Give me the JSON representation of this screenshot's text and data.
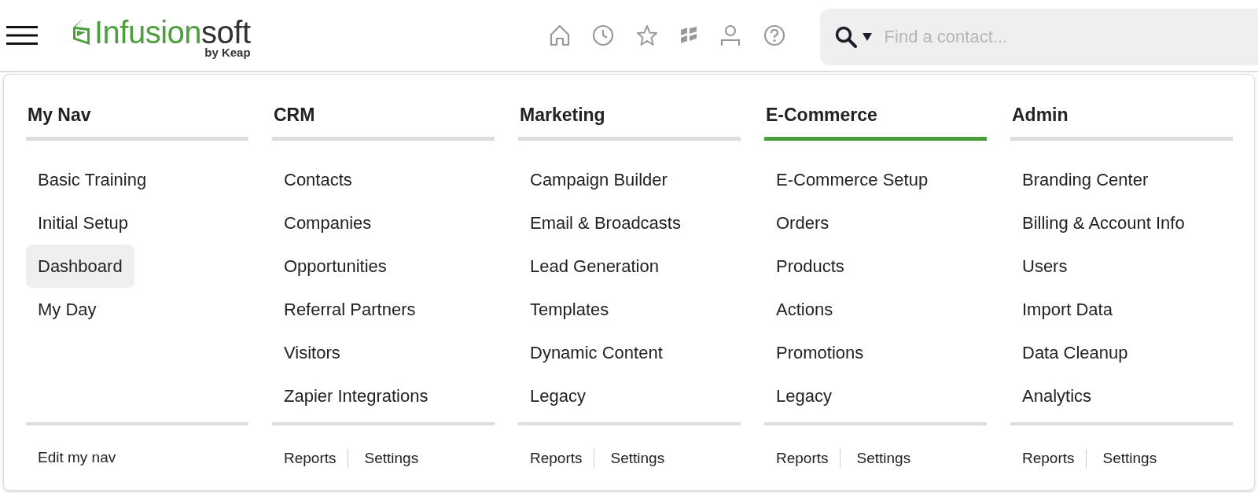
{
  "header": {
    "brand": {
      "primary": "Infusion",
      "secondary": "soft",
      "tagline": "by Keap"
    },
    "search": {
      "placeholder": "Find a contact..."
    }
  },
  "columns": [
    {
      "title": "My Nav",
      "selected": false,
      "items": [
        {
          "label": "Basic Training",
          "selected": false
        },
        {
          "label": "Initial Setup",
          "selected": false
        },
        {
          "label": "Dashboard",
          "selected": true
        },
        {
          "label": "My Day",
          "selected": false
        }
      ],
      "footer": [
        "Edit my nav"
      ]
    },
    {
      "title": "CRM",
      "selected": false,
      "items": [
        {
          "label": "Contacts",
          "selected": false
        },
        {
          "label": "Companies",
          "selected": false
        },
        {
          "label": "Opportunities",
          "selected": false
        },
        {
          "label": "Referral Partners",
          "selected": false
        },
        {
          "label": "Visitors",
          "selected": false
        },
        {
          "label": "Zapier Integrations",
          "selected": false
        }
      ],
      "footer": [
        "Reports",
        "Settings"
      ]
    },
    {
      "title": "Marketing",
      "selected": false,
      "items": [
        {
          "label": "Campaign Builder",
          "selected": false
        },
        {
          "label": "Email & Broadcasts",
          "selected": false
        },
        {
          "label": "Lead Generation",
          "selected": false
        },
        {
          "label": "Templates",
          "selected": false
        },
        {
          "label": "Dynamic Content",
          "selected": false
        },
        {
          "label": "Legacy",
          "selected": false
        }
      ],
      "footer": [
        "Reports",
        "Settings"
      ]
    },
    {
      "title": "E-Commerce",
      "selected": true,
      "items": [
        {
          "label": "E-Commerce Setup",
          "selected": false
        },
        {
          "label": "Orders",
          "selected": false
        },
        {
          "label": "Products",
          "selected": false
        },
        {
          "label": "Actions",
          "selected": false
        },
        {
          "label": "Promotions",
          "selected": false
        },
        {
          "label": "Legacy",
          "selected": false
        }
      ],
      "footer": [
        "Reports",
        "Settings"
      ]
    },
    {
      "title": "Admin",
      "selected": false,
      "items": [
        {
          "label": "Branding Center",
          "selected": false
        },
        {
          "label": "Billing & Account Info",
          "selected": false
        },
        {
          "label": "Users",
          "selected": false
        },
        {
          "label": "Import Data",
          "selected": false
        },
        {
          "label": "Data Cleanup",
          "selected": false
        },
        {
          "label": "Analytics",
          "selected": false
        }
      ],
      "footer": [
        "Reports",
        "Settings"
      ]
    }
  ]
}
